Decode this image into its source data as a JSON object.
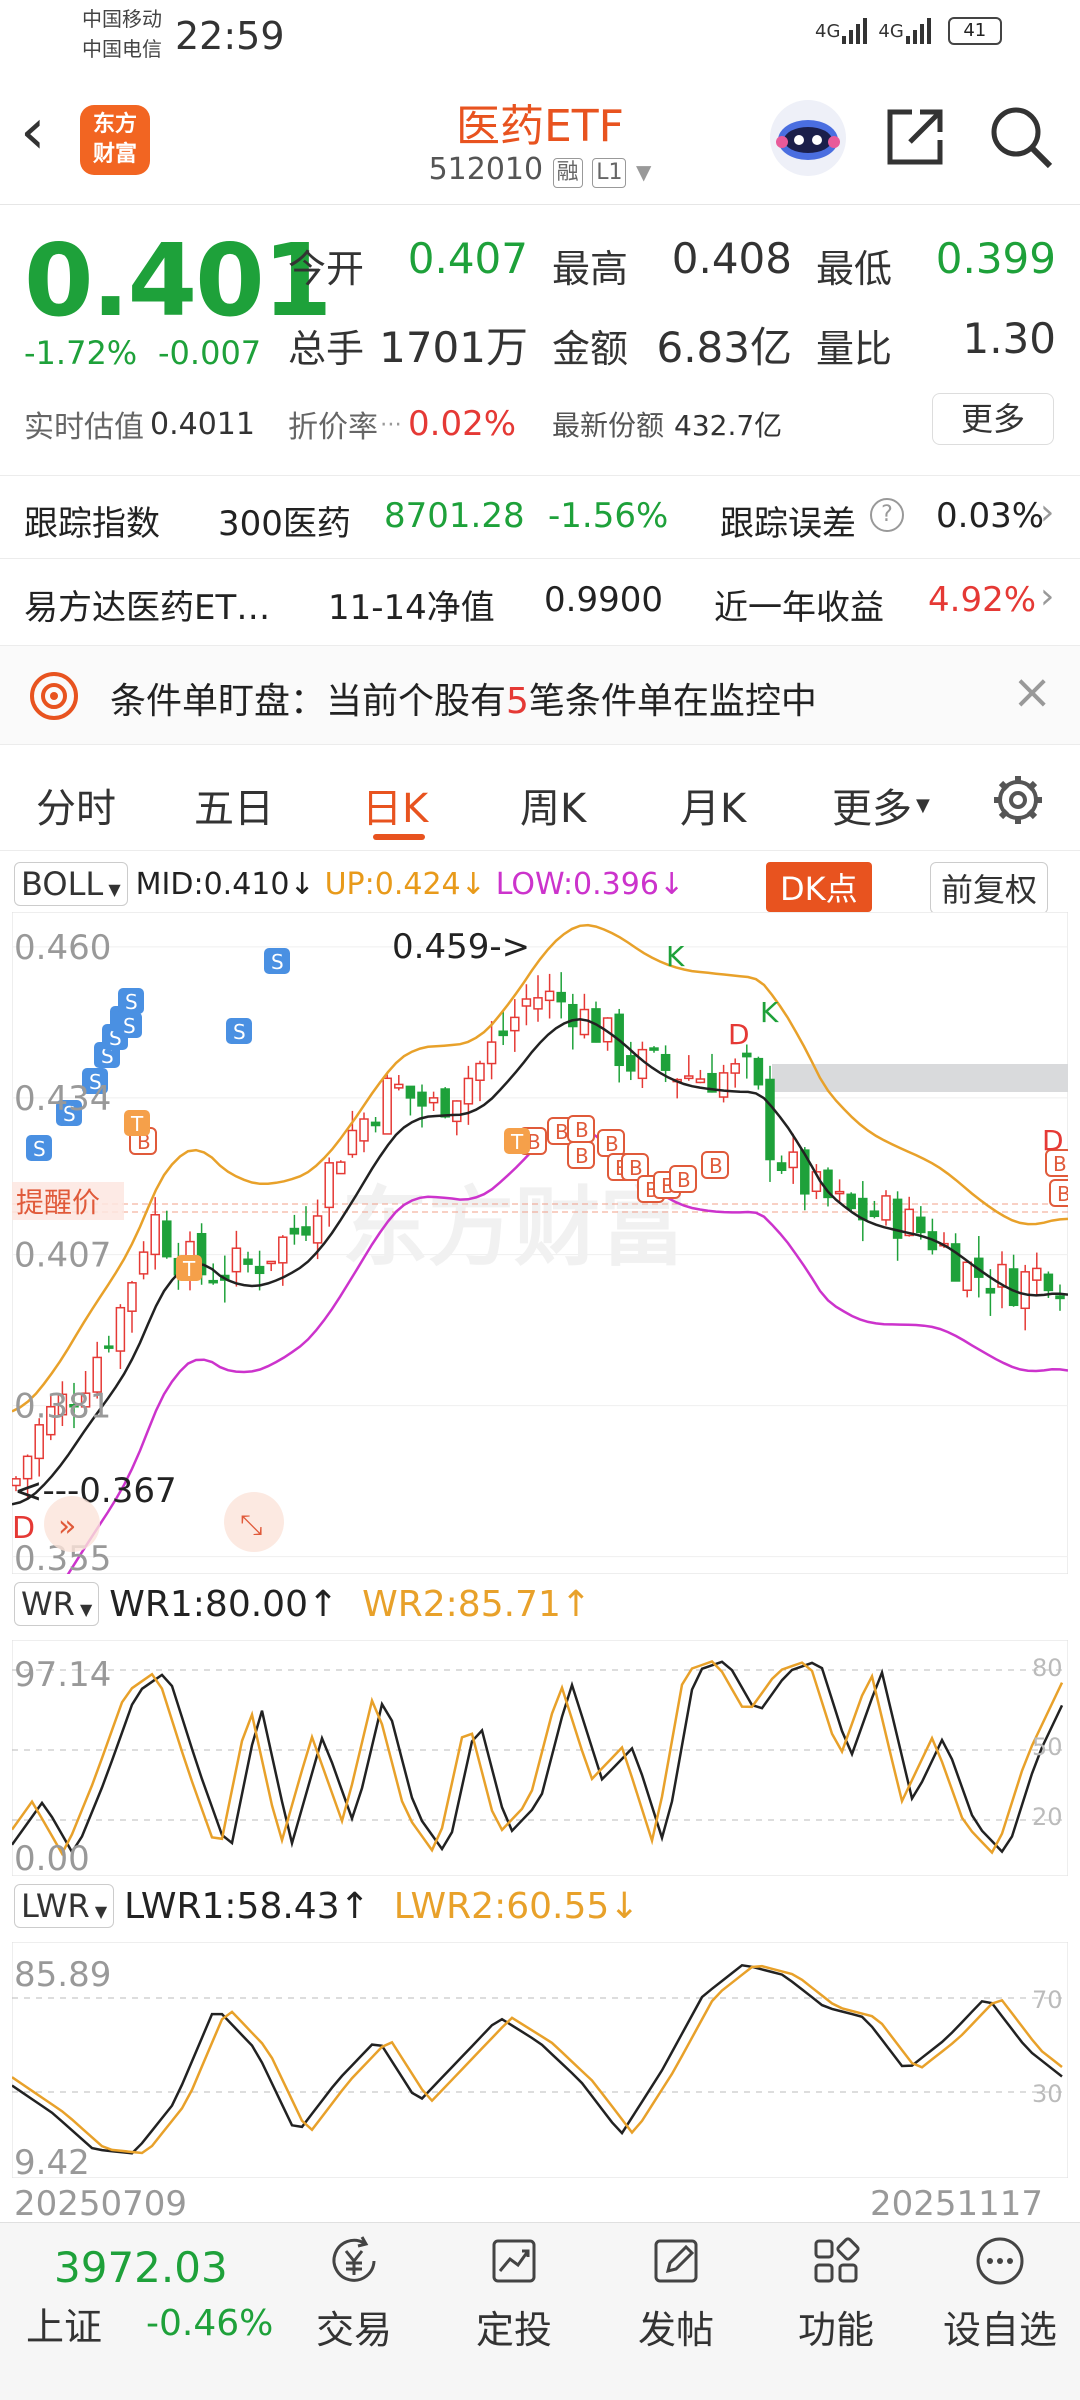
{
  "status_bar": {
    "carrier_1": "中国移动",
    "carrier_2": "中国电信",
    "time": "22:59",
    "net_1": "4G",
    "net_2": "4G",
    "battery": "41"
  },
  "header": {
    "logo_text_1": "东方",
    "logo_text_2": "财富",
    "title": "医药ETF",
    "code": "512010",
    "tag_margin": "融",
    "tag_level": "L1"
  },
  "quote": {
    "price": "0.401",
    "change_pct": "-1.72%",
    "change_abs": "-0.007",
    "open_label": "今开",
    "open": "0.407",
    "high_label": "最高",
    "high": "0.408",
    "low_label": "最低",
    "low": "0.399",
    "volume_label": "总手",
    "volume": "1701万",
    "amount_label": "金额",
    "amount": "6.83亿",
    "ratio_label": "量比",
    "ratio": "1.30",
    "iopv_label": "实时估值",
    "iopv": "0.4011",
    "discount_label": "折价率",
    "discount": "0.02%",
    "shares_label": "最新份额",
    "shares": "432.7亿",
    "more_label": "更多"
  },
  "tracking": {
    "label": "跟踪指数",
    "index_name": "300医药",
    "index_value": "8701.28",
    "index_change": "-1.56%",
    "error_label": "跟踪误差",
    "error_value": "0.03%"
  },
  "fund": {
    "name": "易方达医药ET…",
    "nav_label": "11-14净值",
    "nav_value": "0.9900",
    "return_label": "近一年收益",
    "return_value": "4.92%"
  },
  "alert": {
    "text_before": "条件单盯盘：当前个股有",
    "count": "5",
    "text_after": "笔条件单在监控中"
  },
  "tabs": [
    "分时",
    "五日",
    "日K",
    "周K",
    "月K",
    "更多"
  ],
  "boll": {
    "selector": "BOLL",
    "mid": "MID:0.410",
    "up": "UP:0.424",
    "low": "LOW:0.396",
    "dk_label": "DK点",
    "adjust_label": "前复权"
  },
  "kchart": {
    "y_labels": [
      "0.460",
      "0.434",
      "0.407",
      "0.381",
      "0.355"
    ],
    "high_marker": "0.459->",
    "low_marker": "<---0.367",
    "alert_label": "提醒价",
    "watermark": "东方财富"
  },
  "wr": {
    "selector": "WR",
    "wr1": "WR1:80.00",
    "wr2": "WR2:85.71",
    "top": "97.14",
    "bottom": "0.00",
    "ref_80": "80",
    "ref_50": "50",
    "ref_20": "20"
  },
  "lwr": {
    "selector": "LWR",
    "lwr1": "LWR1:58.43",
    "lwr2": "LWR2:60.55",
    "top": "85.89",
    "bottom": "9.42",
    "ref_70": "70",
    "ref_30": "30"
  },
  "dates": {
    "start": "20250709",
    "end": "20251117"
  },
  "bottom": {
    "index_value": "3972.03",
    "index_name": "上证",
    "index_change": "-0.46%",
    "nav": [
      "交易",
      "定投",
      "发帖",
      "功能",
      "设自选"
    ]
  }
}
